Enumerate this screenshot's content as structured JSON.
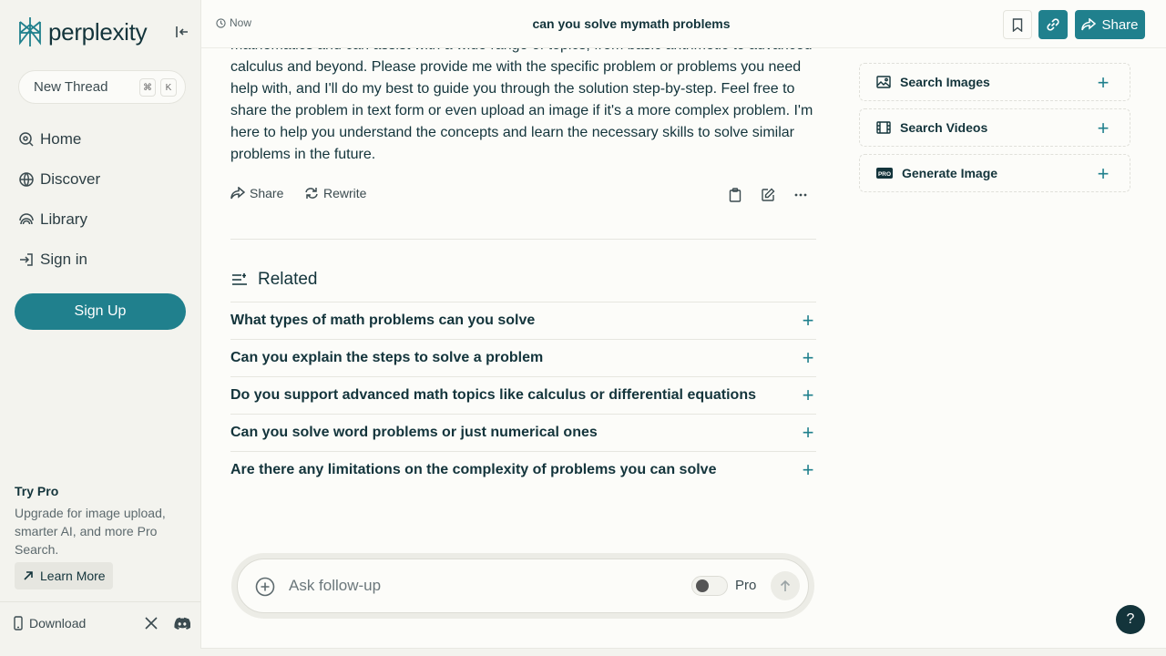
{
  "sidebar": {
    "logo_text": "perplexity",
    "new_thread": {
      "label": "New Thread",
      "shortcut_mod": "⌘",
      "shortcut_key": "K"
    },
    "nav": [
      {
        "label": "Home",
        "icon": "home-icon"
      },
      {
        "label": "Discover",
        "icon": "globe-icon"
      },
      {
        "label": "Library",
        "icon": "library-icon"
      },
      {
        "label": "Sign in",
        "icon": "sign-in-icon"
      }
    ],
    "signup_label": "Sign Up",
    "try_pro": {
      "title": "Try Pro",
      "description": "Upgrade for image upload, smarter AI, and more Pro Search.",
      "learn_more": "Learn More"
    },
    "download_label": "Download"
  },
  "topbar": {
    "time_label": "Now",
    "title": "can you solve mymath problems",
    "share_label": "Share"
  },
  "answer": {
    "text": "mathematics and can assist with a wide range of topics, from basic arithmetic to advanced calculus and beyond. Please provide me with the specific problem or problems you need help with, and I'll do my best to guide you through the solution step-by-step. Feel free to share the problem in text form or even upload an image if it's a more complex problem. I'm here to help you understand the concepts and learn the necessary skills to solve similar problems in the future.",
    "share_label": "Share",
    "rewrite_label": "Rewrite"
  },
  "related": {
    "heading": "Related",
    "items": [
      "What types of math problems can you solve",
      "Can you explain the steps to solve a problem",
      "Do you support advanced math topics like calculus or differential equations",
      "Can you solve word problems or just numerical ones",
      "Are there any limitations on the complexity of problems you can solve"
    ]
  },
  "side_actions": [
    {
      "label": "Search Images",
      "icon": "image-icon"
    },
    {
      "label": "Search Videos",
      "icon": "film-icon"
    },
    {
      "label": "Generate Image",
      "icon": "pro-badge-icon"
    }
  ],
  "followup": {
    "placeholder": "Ask follow-up",
    "pro_label": "Pro",
    "pro_enabled": false
  },
  "help_label": "?",
  "colors": {
    "accent": "#20808d",
    "text": "#13343b",
    "sidebar_bg": "#f3f3ee",
    "main_bg": "#fcfcf9"
  }
}
